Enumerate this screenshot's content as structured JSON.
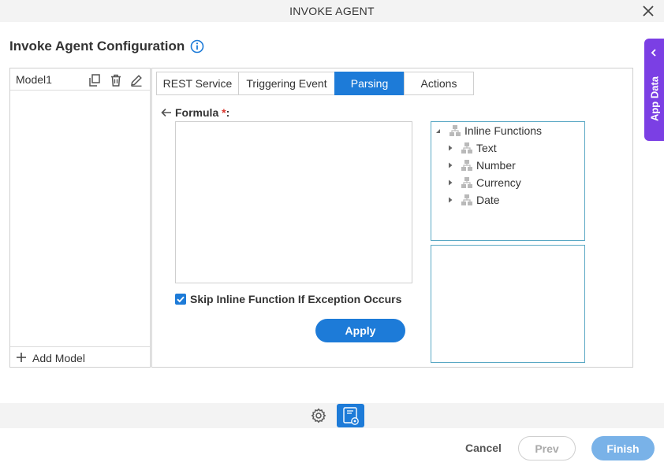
{
  "dialog": {
    "title": "INVOKE AGENT",
    "page_title": "Invoke Agent Configuration"
  },
  "app_data": {
    "label": "App Data"
  },
  "models": {
    "items": [
      {
        "name": "Model1"
      }
    ],
    "add_label": "Add Model"
  },
  "tabs": [
    {
      "label": "REST Service",
      "active": false
    },
    {
      "label": "Triggering Event",
      "active": false
    },
    {
      "label": "Parsing",
      "active": true
    },
    {
      "label": "Actions",
      "active": false
    }
  ],
  "formula": {
    "label": "Formula",
    "required_mark": "*",
    "suffix": ":",
    "value": ""
  },
  "skip_option": {
    "label": "Skip Inline Function If Exception Occurs",
    "checked": true
  },
  "apply_label": "Apply",
  "tree": {
    "root": "Inline Functions",
    "children": [
      "Text",
      "Number",
      "Currency",
      "Date"
    ]
  },
  "footer": {
    "cancel": "Cancel",
    "prev": "Prev",
    "finish": "Finish"
  },
  "colors": {
    "accent": "#1d7bd8",
    "app_data_tab": "#7b3fe4",
    "finish_disabled": "#79b2e8",
    "required": "#d9342b"
  }
}
